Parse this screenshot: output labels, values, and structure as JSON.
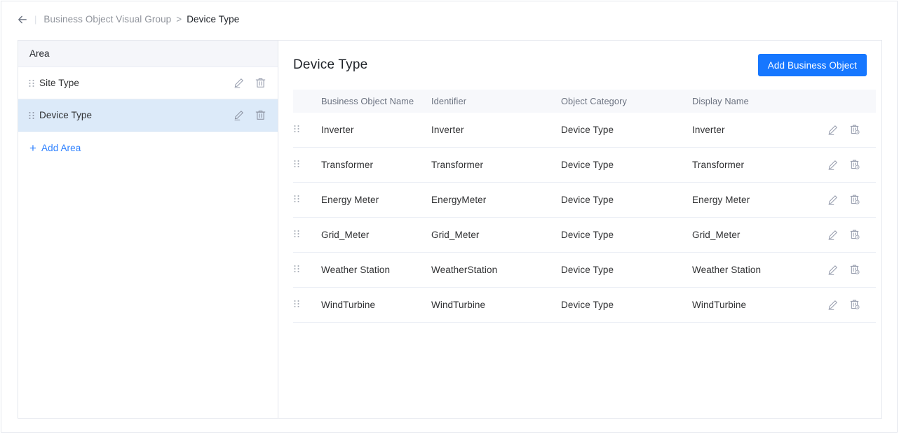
{
  "breadcrumb": {
    "back_icon": "arrow-left-icon",
    "divider": "|",
    "parent": "Business Object Visual Group",
    "separator": ">",
    "current": "Device Type"
  },
  "sidebar": {
    "header": "Area",
    "items": [
      {
        "label": "Site Type",
        "selected": false,
        "drag_icon": "drag-handle-icon",
        "edit_icon": "edit-pencil-icon",
        "delete_icon": "trash-icon"
      },
      {
        "label": "Device Type",
        "selected": true,
        "drag_icon": "drag-handle-icon",
        "edit_icon": "edit-pencil-icon",
        "delete_icon": "trash-icon"
      }
    ],
    "add_area": {
      "label": "Add Area",
      "plus": "+",
      "icon": "plus-icon"
    }
  },
  "main": {
    "title": "Device Type",
    "add_button": "Add Business Object",
    "table": {
      "columns": [
        "Business Object Name",
        "Identifier",
        "Object Category",
        "Display Name"
      ],
      "rows": [
        {
          "name": "Inverter",
          "identifier": "Inverter",
          "category": "Device Type",
          "display": "Inverter"
        },
        {
          "name": "Transformer",
          "identifier": "Transformer",
          "category": "Device Type",
          "display": "Transformer"
        },
        {
          "name": "Energy Meter",
          "identifier": "EnergyMeter",
          "category": "Device Type",
          "display": "Energy Meter"
        },
        {
          "name": "Grid_Meter",
          "identifier": "Grid_Meter",
          "category": "Device Type",
          "display": "Grid_Meter"
        },
        {
          "name": "Weather Station",
          "identifier": "WeatherStation",
          "category": "Device Type",
          "display": "Weather Station"
        },
        {
          "name": "WindTurbine",
          "identifier": "WindTurbine",
          "category": "Device Type",
          "display": "WindTurbine"
        }
      ],
      "row_icons": {
        "drag": "drag-handle-icon",
        "edit": "edit-pencil-icon",
        "delete": "trash-settings-icon"
      }
    }
  },
  "colors": {
    "accent": "#1677ff",
    "link": "#2b7fff",
    "selected_row": "#dceaf9",
    "header_bg": "#f5f6fa",
    "table_header_bg": "#f7f8fb",
    "border": "#e4e7ed",
    "icon": "#9aa0b0",
    "text": "#303133",
    "muted_text": "#8f939b"
  }
}
